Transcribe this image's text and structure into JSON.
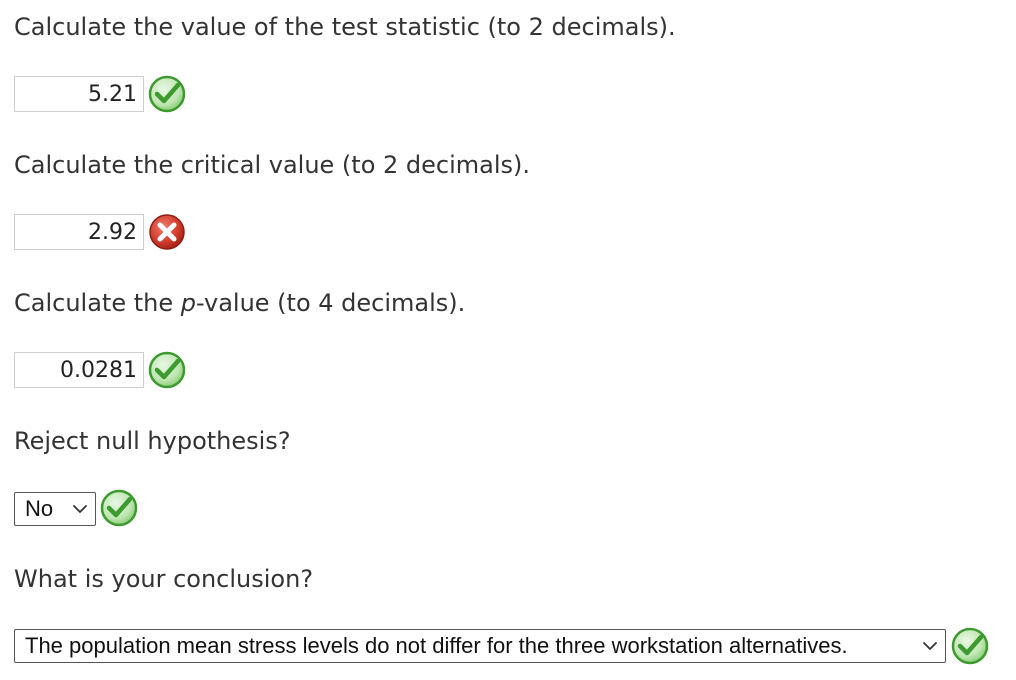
{
  "questions": {
    "q1": {
      "prompt": "Calculate the value of the test statistic (to 2 decimals).",
      "answer": "5.21",
      "status": "correct"
    },
    "q2": {
      "prompt": "Calculate the critical value (to 2 decimals).",
      "answer": "2.92",
      "status": "incorrect"
    },
    "q3": {
      "prompt_before": "Calculate the ",
      "prompt_italic": "p",
      "prompt_after": "-value (to 4 decimals).",
      "answer": "0.0281",
      "status": "correct"
    },
    "q4": {
      "prompt": "Reject null hypothesis?",
      "selected": "No",
      "status": "correct"
    },
    "q5": {
      "prompt": "What is your conclusion?",
      "selected": "The population mean stress levels do not differ for the three workstation alternatives.",
      "status": "correct"
    }
  },
  "icons": {
    "correct": "check-circle-icon",
    "incorrect": "x-circle-icon",
    "dropdown": "chevron-down-icon"
  },
  "colors": {
    "correct_green": "#5cb85c",
    "incorrect_red": "#c0392b",
    "text": "#333333"
  }
}
